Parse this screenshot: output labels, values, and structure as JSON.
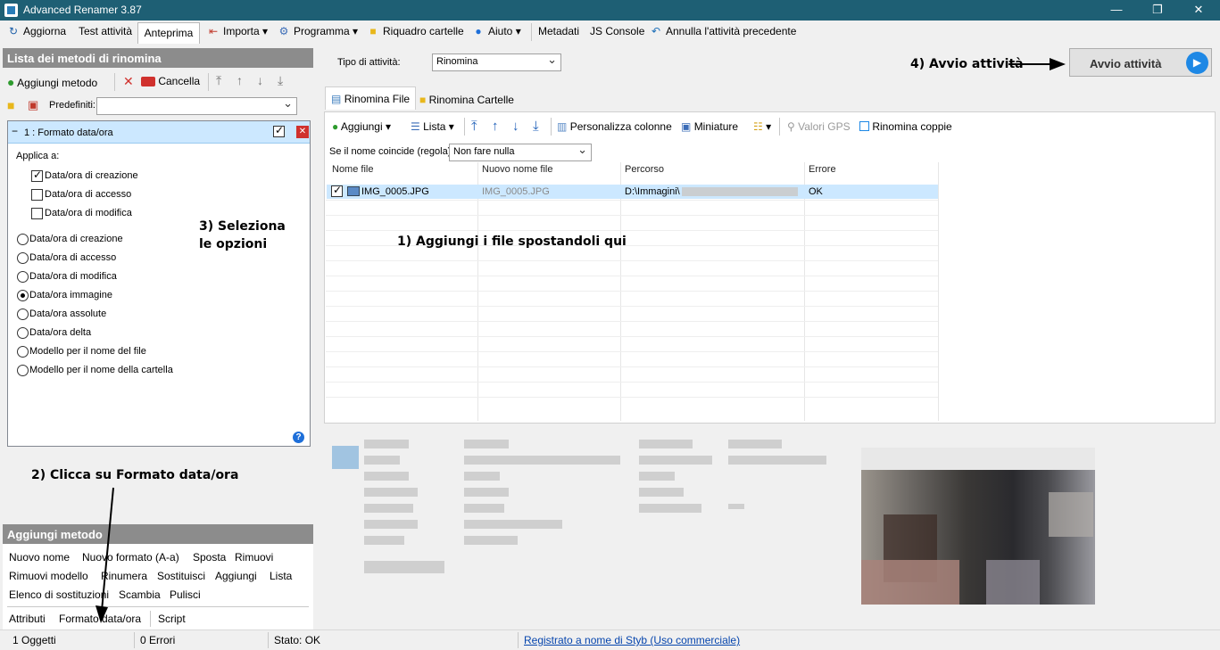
{
  "window": {
    "title": "Advanced Renamer 3.87"
  },
  "menubar": {
    "items": [
      "Aggiorna",
      "Test attività",
      "Anteprima",
      "Importa",
      "Programma",
      "Riquadro cartelle",
      "Aiuto",
      "Metadati",
      "JS Console",
      "Annulla l'attività precedente"
    ]
  },
  "methods_panel": {
    "header": "Lista dei metodi di rinomina",
    "add_label": "Aggiungi metodo",
    "delete_label": "Cancella",
    "presets_label": "Predefiniti:",
    "method_title": "1 : Formato data/ora",
    "apply_to": "Applica a:",
    "checkboxes": [
      {
        "label": "Data/ora di creazione",
        "checked": true
      },
      {
        "label": "Data/ora di accesso",
        "checked": false
      },
      {
        "label": "Data/ora di modifica",
        "checked": false
      }
    ],
    "radios": [
      {
        "label": "Data/ora di creazione",
        "selected": false
      },
      {
        "label": "Data/ora di accesso",
        "selected": false
      },
      {
        "label": "Data/ora di modifica",
        "selected": false
      },
      {
        "label": "Data/ora immagine",
        "selected": true
      },
      {
        "label": "Data/ora assolute",
        "selected": false
      },
      {
        "label": "Data/ora delta",
        "selected": false
      },
      {
        "label": "Modello per il nome del file",
        "selected": false
      },
      {
        "label": "Modello per il nome della cartella",
        "selected": false
      }
    ]
  },
  "add_method_panel": {
    "header": "Aggiungi metodo",
    "row1": [
      "Nuovo nome",
      "Nuovo formato (A-a)",
      "Sposta",
      "Rimuovi"
    ],
    "row2": [
      "Rimuovi modello",
      "Rinumera",
      "Sostituisci",
      "Aggiungi",
      "Lista"
    ],
    "row3": [
      "Elenco di sostituzioni",
      "Scambia",
      "Pulisci"
    ],
    "row4": [
      "Attributi",
      "Formato data/ora",
      "Script"
    ]
  },
  "main": {
    "task_type_label": "Tipo di attività:",
    "task_type_value": "Rinomina",
    "start_button": "Avvio attività",
    "tabs": [
      "Rinomina File",
      "Rinomina Cartelle"
    ],
    "toolbar": [
      "Aggiungi",
      "Lista",
      "Personalizza colonne",
      "Miniature",
      "Valori GPS",
      "Rinomina coppie"
    ],
    "collision_label": "Se il nome coincide (regola):",
    "collision_value": "Non fare nulla",
    "columns": [
      "Nome file",
      "Nuovo nome file",
      "Percorso",
      "Errore"
    ],
    "rows": [
      {
        "name": "IMG_0005.JPG",
        "new_name": "IMG_0005.JPG",
        "path": "D:\\Immagini\\",
        "error": "OK"
      }
    ]
  },
  "annotations": {
    "step1": "1) Aggiungi i file spostandoli qui",
    "step2": "2) Clicca su Formato data/ora",
    "step3a": "3) Seleziona",
    "step3b": "le opzioni",
    "step4": "4) Avvio attività"
  },
  "statusbar": {
    "objects": "1 Oggetti",
    "errors": "0 Errori",
    "state": "Stato: OK",
    "registered": "Registrato a nome di Styb (Uso commerciale)"
  },
  "colors": {
    "titlebar": "#1e5f74",
    "selected_row": "#cce8ff",
    "link": "#0645ad",
    "start_icon": "#1e88e5"
  }
}
